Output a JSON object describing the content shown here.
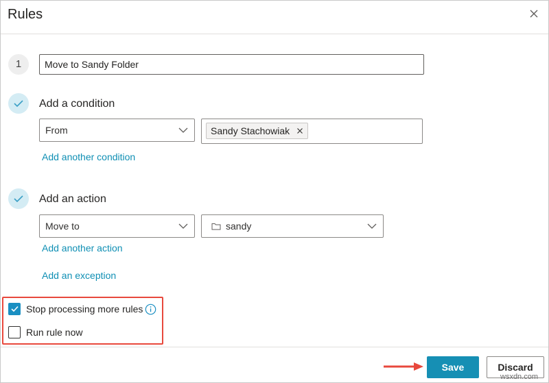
{
  "dialog": {
    "title": "Rules"
  },
  "rule": {
    "number": "1",
    "name": "Move to Sandy Folder"
  },
  "condition": {
    "title": "Add a condition",
    "field": "From",
    "value_chip": "Sandy Stachowiak",
    "add_link": "Add another condition"
  },
  "action": {
    "title": "Add an action",
    "field": "Move to",
    "folder": "sandy",
    "add_link": "Add another action"
  },
  "exception": {
    "add_link": "Add an exception"
  },
  "options": {
    "stop_processing": {
      "label": "Stop processing more rules",
      "checked": true
    },
    "run_now": {
      "label": "Run rule now",
      "checked": false
    }
  },
  "buttons": {
    "save": "Save",
    "discard": "Discard"
  },
  "watermark": "wsxdn.com",
  "colors": {
    "accent": "#168fb4",
    "link": "#0f8fb4",
    "highlight_box": "#e8483c",
    "check_bg": "#d4ecf4"
  }
}
